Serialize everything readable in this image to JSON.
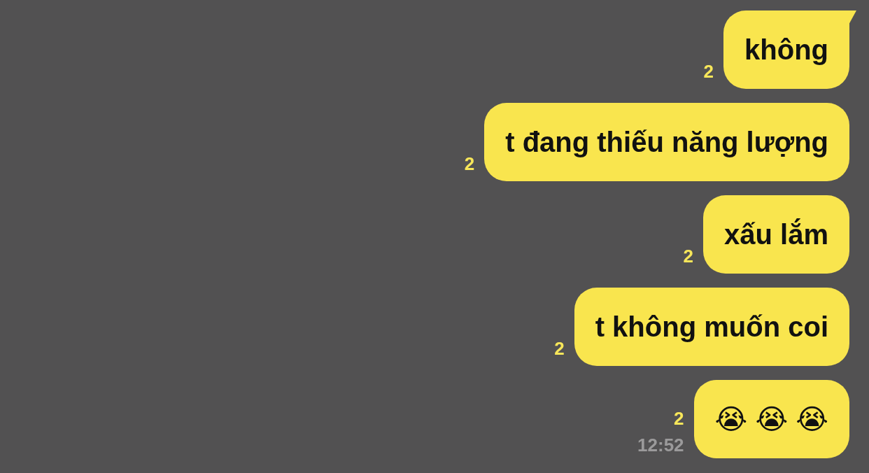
{
  "messages": [
    {
      "text": "không",
      "unread": "2",
      "tail": true
    },
    {
      "text": "t đang thiếu năng lượng",
      "unread": "2",
      "tail": false
    },
    {
      "text": "xấu lắm",
      "unread": "2",
      "tail": false
    },
    {
      "text": "t không muốn coi",
      "unread": "2",
      "tail": false
    },
    {
      "text": "😭 😭 😭",
      "unread": "2",
      "tail": false,
      "time": "12:52"
    }
  ]
}
